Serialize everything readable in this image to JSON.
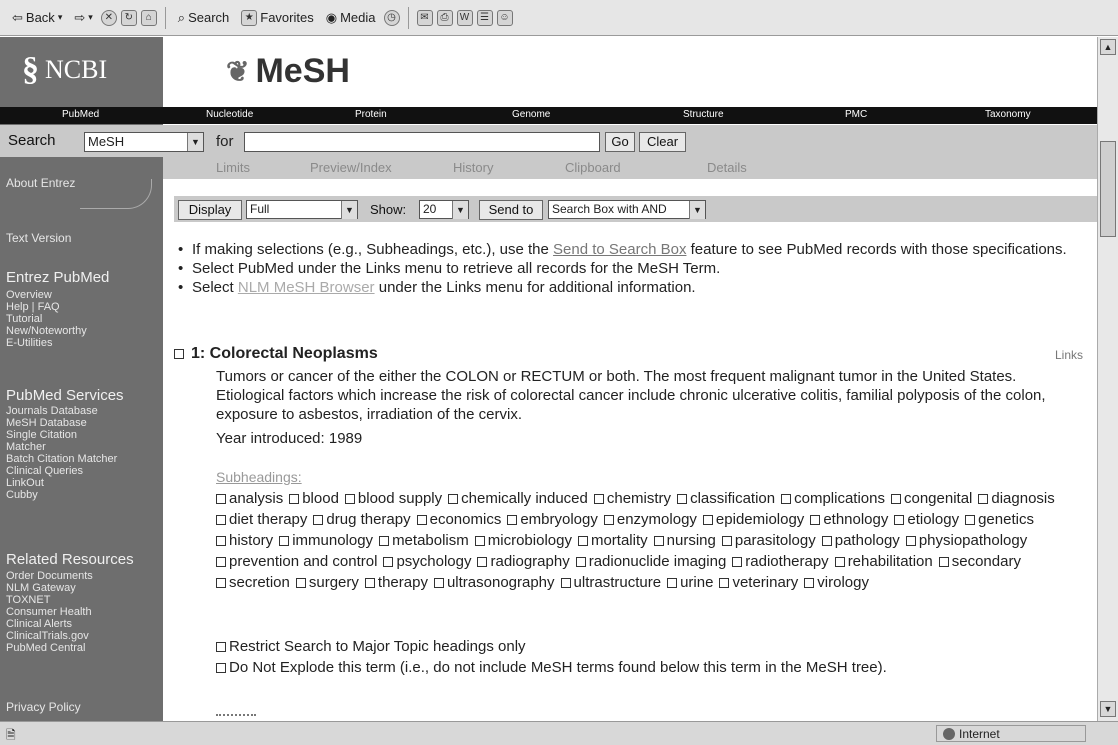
{
  "toolbar": {
    "back": "Back",
    "search": "Search",
    "favorites": "Favorites",
    "media": "Media"
  },
  "sidebar": {
    "logo": "NCBI",
    "about": "About Entrez",
    "text_version": "Text Version",
    "entrez_heading": "Entrez PubMed",
    "entrez_items": [
      "Overview",
      "Help | FAQ",
      "Tutorial",
      "New/Noteworthy",
      "E-Utilities"
    ],
    "services_heading": "PubMed Services",
    "services_items": [
      "Journals Database",
      "MeSH Database",
      "Single Citation",
      "Matcher",
      "Batch Citation Matcher",
      "Clinical Queries",
      "LinkOut",
      "Cubby"
    ],
    "related_heading": "Related Resources",
    "related_items": [
      "Order Documents",
      "NLM Gateway",
      "TOXNET",
      "Consumer Health",
      "Clinical Alerts",
      "ClinicalTrials.gov",
      "PubMed Central"
    ],
    "privacy": "Privacy Policy"
  },
  "header": {
    "title": "MeSH"
  },
  "nav": [
    "PubMed",
    "Nucleotide",
    "Protein",
    "Genome",
    "Structure",
    "PMC",
    "Taxonomy"
  ],
  "search": {
    "label": "Search",
    "database": "MeSH",
    "for_label": "for",
    "term": "",
    "go": "Go",
    "clear": "Clear"
  },
  "tabs": [
    "Limits",
    "Preview/Index",
    "History",
    "Clipboard",
    "Details"
  ],
  "display": {
    "display_btn": "Display",
    "format": "Full",
    "show_label": "Show:",
    "show_value": "20",
    "send_btn": "Send to",
    "send_target": "Search Box with AND"
  },
  "instructions": {
    "b1_pre": "If making selections (e.g., Subheadings, etc.), use the ",
    "b1_link": "Send to Search Box",
    "b1_post": " feature to see PubMed records with those specifications.",
    "b2": "Select PubMed under the Links menu to retrieve all records for the MeSH Term.",
    "b3_pre": "Select ",
    "b3_link": "NLM MeSH Browser",
    "b3_post": " under the Links menu for additional information."
  },
  "record": {
    "number_title": "1: Colorectal Neoplasms",
    "links": "Links",
    "description": "Tumors or cancer of the either the COLON or RECTUM or both. The most frequent malignant tumor in the United States. Etiological factors which increase the risk of colorectal cancer include chronic ulcerative colitis, familial polyposis of the colon, exposure to asbestos, irradiation of the cervix.",
    "year": "Year introduced: 1989",
    "subheadings_label": "Subheadings:",
    "subheadings": [
      "analysis",
      "blood",
      "blood supply",
      "chemically induced",
      "chemistry",
      "classification",
      "complications",
      "congenital",
      "diagnosis",
      "diet therapy",
      "drug therapy",
      "economics",
      "embryology",
      "enzymology",
      "epidemiology",
      "ethnology",
      "etiology",
      "genetics",
      "history",
      "immunology",
      "metabolism",
      "microbiology",
      "mortality",
      "nursing",
      "parasitology",
      "pathology",
      "physiopathology",
      "prevention and control",
      "psychology",
      "radiography",
      "radionuclide imaging",
      "radiotherapy",
      "rehabilitation",
      "secondary",
      "secretion",
      "surgery",
      "therapy",
      "ultrasonography",
      "ultrastructure",
      "urine",
      "veterinary",
      "virology"
    ],
    "restrict": "Restrict Search to Major Topic headings only",
    "explode": "Do Not Explode this term (i.e., do not include MeSH terms found below this term in the MeSH tree)."
  },
  "status": {
    "zone": "Internet"
  }
}
